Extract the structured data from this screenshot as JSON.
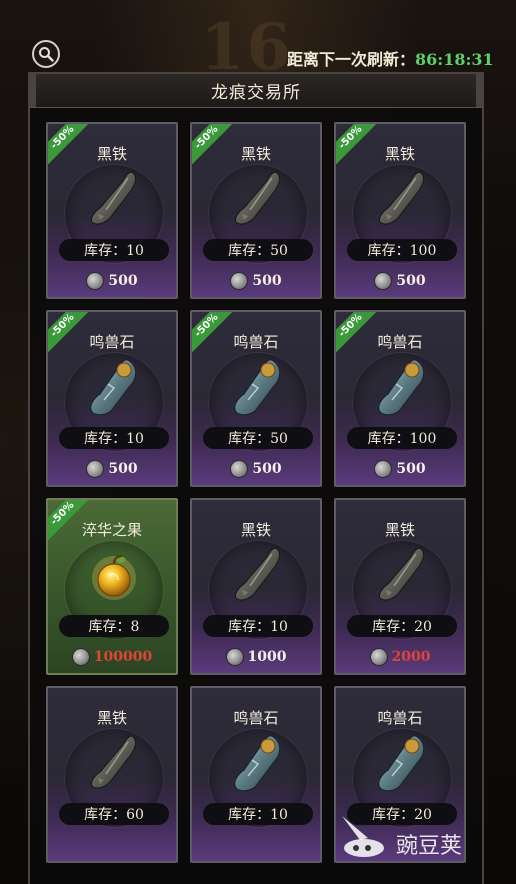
{
  "background": {
    "deco_text": "16"
  },
  "header": {
    "refresh_label": "距离下一次刷新：",
    "refresh_time": "86:18:31"
  },
  "panel": {
    "title": "龙痕交易所"
  },
  "items": [
    {
      "name": "黑铁",
      "stock_label": "库存：10",
      "price": "500",
      "discount": "-50%",
      "icon": "black-iron-icon",
      "theme": "purple",
      "price_color": "white"
    },
    {
      "name": "黑铁",
      "stock_label": "库存：50",
      "price": "500",
      "discount": "-50%",
      "icon": "black-iron-icon",
      "theme": "purple",
      "price_color": "white"
    },
    {
      "name": "黑铁",
      "stock_label": "库存：100",
      "price": "500",
      "discount": "-50%",
      "icon": "black-iron-icon",
      "theme": "purple",
      "price_color": "white"
    },
    {
      "name": "鸣兽石",
      "stock_label": "库存：10",
      "price": "500",
      "discount": "-50%",
      "icon": "beast-stone-icon",
      "theme": "purple",
      "price_color": "white"
    },
    {
      "name": "鸣兽石",
      "stock_label": "库存：50",
      "price": "500",
      "discount": "-50%",
      "icon": "beast-stone-icon",
      "theme": "purple",
      "price_color": "white"
    },
    {
      "name": "鸣兽石",
      "stock_label": "库存：100",
      "price": "500",
      "discount": "-50%",
      "icon": "beast-stone-icon",
      "theme": "purple",
      "price_color": "white"
    },
    {
      "name": "淬华之果",
      "stock_label": "库存：8",
      "price": "100000",
      "discount": "-50%",
      "icon": "golden-fruit-icon",
      "theme": "green",
      "price_color": "red"
    },
    {
      "name": "黑铁",
      "stock_label": "库存：10",
      "price": "1000",
      "discount": "",
      "icon": "black-iron-icon",
      "theme": "purple",
      "price_color": "white"
    },
    {
      "name": "黑铁",
      "stock_label": "库存：20",
      "price": "2000",
      "discount": "",
      "icon": "black-iron-icon",
      "theme": "purple",
      "price_color": "red"
    },
    {
      "name": "黑铁",
      "stock_label": "库存：60",
      "price": "",
      "discount": "",
      "icon": "black-iron-icon",
      "theme": "purple",
      "price_color": "white"
    },
    {
      "name": "鸣兽石",
      "stock_label": "库存：10",
      "price": "",
      "discount": "",
      "icon": "beast-stone-icon",
      "theme": "purple",
      "price_color": "white"
    },
    {
      "name": "鸣兽石",
      "stock_label": "库存：20",
      "price": "",
      "discount": "",
      "icon": "beast-stone-icon",
      "theme": "purple",
      "price_color": "white"
    }
  ],
  "watermark": {
    "text": "豌豆荚",
    "icon": "wandoujia-logo-icon"
  },
  "colors": {
    "timer": "#5fd06a",
    "discount": "#3a9a3a",
    "price_red": "#e0443a"
  }
}
